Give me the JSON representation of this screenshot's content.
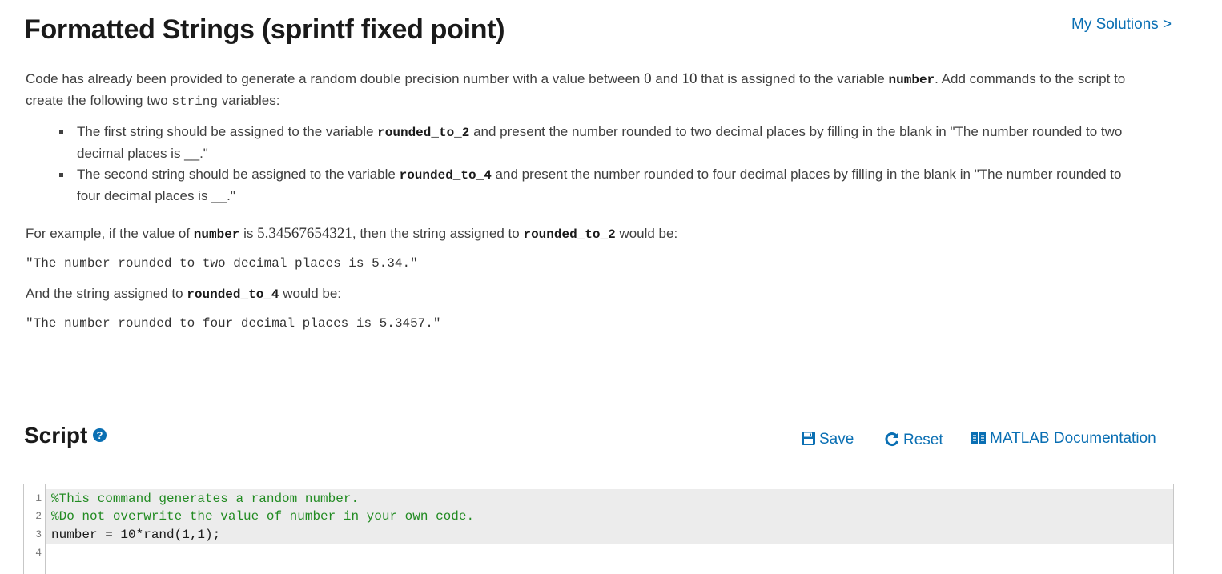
{
  "problem": {
    "title": "Formatted Strings (sprintf fixed point)",
    "my_solutions": "My Solutions >",
    "intro": {
      "t1": "Code has already been provided to generate a random double precision number with a value between ",
      "n0": "0",
      "and": " and ",
      "n10": "10",
      "t2": " that is assigned to the variable ",
      "var_number": "number",
      "t3": ". Add commands to the script to create the following two ",
      "string_kw": "string",
      "t4": " variables:"
    },
    "bullets": [
      {
        "pre": "The first string should be assigned to the variable ",
        "var": "rounded_to_2",
        "post": " and present the number rounded to two decimal places by filling in the blank in \"The number rounded to two decimal places is __.\""
      },
      {
        "pre": "The second string should be assigned to the variable ",
        "var": "rounded_to_4",
        "post": " and present the number rounded to four decimal places by filling in the blank in \"The number rounded to four decimal places is __.\""
      }
    ],
    "example": {
      "t1": "For example, if the value of ",
      "var_number": "number",
      "t2": " is ",
      "value": "5.34567654321",
      "t3": ", then the string assigned to ",
      "var_r2": "rounded_to_2",
      "t4": " would be:",
      "out1": "\"The number rounded to two decimal places is 5.34.\"",
      "and_t1": "And the string assigned to ",
      "var_r4": "rounded_to_4",
      "and_t2": " would be:",
      "out2": "\"The number rounded to four decimal places is 5.3457.\""
    }
  },
  "script": {
    "heading": "Script",
    "help_icon": "question-circle-icon",
    "toolbar": {
      "save": "Save",
      "reset": "Reset",
      "docs": "MATLAB Documentation"
    },
    "line_numbers": [
      "1",
      "2",
      "3",
      "4"
    ],
    "lines": [
      "%This command generates a random number.",
      "%Do not overwrite the value of number in your own code.",
      "number = 10*rand(1,1);",
      ""
    ]
  },
  "colors": {
    "link": "#0a6fb3",
    "comment": "#228b22",
    "readonly_bg": "#ececec"
  }
}
